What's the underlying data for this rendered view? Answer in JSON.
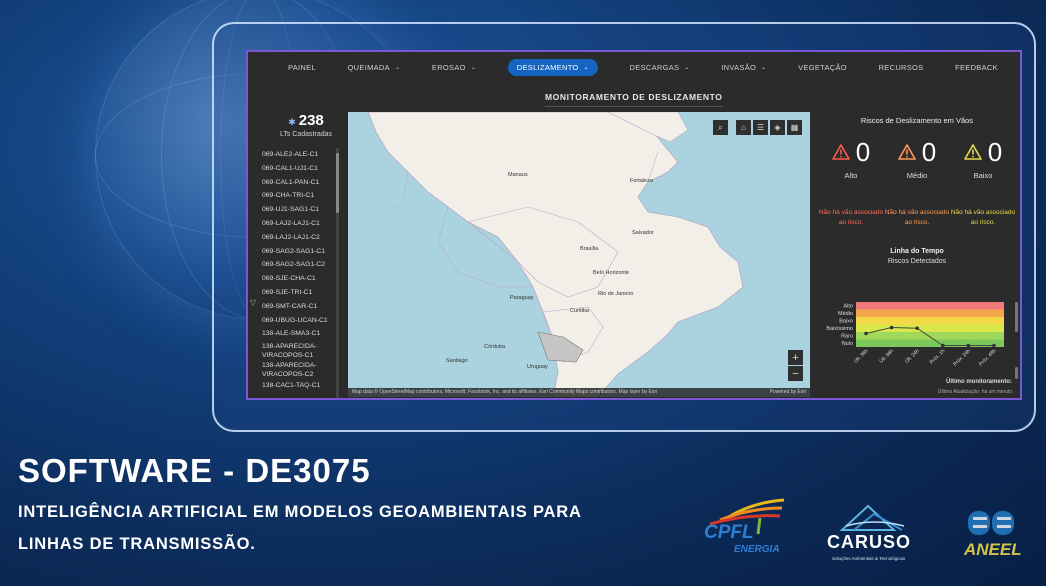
{
  "nav": [
    {
      "label": "PAINEL",
      "chevron": false,
      "active": false
    },
    {
      "label": "QUEIMADA",
      "chevron": true,
      "active": false
    },
    {
      "label": "EROSAO",
      "chevron": true,
      "active": false
    },
    {
      "label": "DESLIZAMENTO",
      "chevron": true,
      "active": true
    },
    {
      "label": "DESCARGAS",
      "chevron": true,
      "active": false
    },
    {
      "label": "INVASÃO",
      "chevron": true,
      "active": false
    },
    {
      "label": "VEGETAÇÃO",
      "chevron": false,
      "active": false
    },
    {
      "label": "RECURSOS",
      "chevron": false,
      "active": false
    },
    {
      "label": "FEEDBACK",
      "chevron": false,
      "active": false
    }
  ],
  "page_title": "MONITORAMENTO DE DESLIZAMENTO",
  "sidebar": {
    "count": "238",
    "count_label": "LTs Cadastradas",
    "items": [
      "069-ALE2-ALE-C1",
      "069-CAL1-UJ1-C1",
      "069-CAL1-PAN-C1",
      "069-CHA-TRI-C1",
      "069-UJ1-SAG1-C1",
      "069-LAJ2-LAJ1-C1",
      "069-LAJ2-LAJ1-C2",
      "069-SAG2-SAG1-C1",
      "069-SAG2-SAG1-C2",
      "069-SJE-CHA-C1",
      "069-SJE-TRI-C1",
      "069-SMT-CAR-C1",
      "069-UBUG-UCAN-C1",
      "138-ALE-SMA3-C1",
      "138-APARECIDA-VIRACOPOS-C1",
      "138-APARECIDA-VIRACOPOS-C2",
      "138-CAC1-TAQ-C1"
    ]
  },
  "map": {
    "cities": [
      "Manaus",
      "Fortaleza",
      "Salvador",
      "Brasília",
      "Belo Horizonte",
      "Rio de Janeiro",
      "Curitiba",
      "Paraguay",
      "Córdoba",
      "Santiago",
      "Uruguay"
    ],
    "attribution": "Map data © OpenStreetMap contributors, Microsoft, Facebook, Inc. and its affiliates, Esri Community Maps contributors, Map layer by Esri",
    "powered": "Powered by Esri",
    "zoom_in": "+",
    "zoom_out": "−"
  },
  "risks": {
    "title": "Riscos de Deslizamento em Vãos",
    "items": [
      {
        "label": "Alto",
        "value": "0",
        "color": "#ff5a4a",
        "msg": "Não há vão associado ao risco."
      },
      {
        "label": "Médio",
        "value": "0",
        "color": "#ff9a55",
        "msg": "Não há vão associado ao risco."
      },
      {
        "label": "Baixo",
        "value": "0",
        "color": "#e9d84a",
        "msg": "Não há vão associado ao risco."
      }
    ]
  },
  "timeline": {
    "title": "Linha do Tempo",
    "subtitle": "Riscos Detectados",
    "last_label": "Último monitoramento:",
    "last_sub": "Última Atualização: há um minuto"
  },
  "chart_data": {
    "type": "line",
    "categories": [
      "Últ. 36h",
      "Últ. 96h",
      "Últ. 24h",
      "Próx. 1h",
      "Próx. 24h",
      "Próx. 48h"
    ],
    "y_levels": [
      "Alto",
      "Médio",
      "Baixo",
      "Baixíssimo",
      "Raro",
      "Nulo"
    ],
    "bands": [
      {
        "level": "Alto",
        "color": "#f07a7a"
      },
      {
        "level": "Médio",
        "color": "#f4a64a"
      },
      {
        "level": "Baixo",
        "color": "#f5d84a"
      },
      {
        "level": "Baixíssimo",
        "color": "#d8e84a"
      },
      {
        "level": "Raro",
        "color": "#9fd85a"
      },
      {
        "level": "Nulo",
        "color": "#7cc85a"
      }
    ],
    "values": [
      1.8,
      2.6,
      2.5,
      0.2,
      0.2,
      0.2
    ],
    "ylim": [
      0,
      6
    ]
  },
  "headline": "SOFTWARE - DE3075",
  "subtitle_lines": [
    "INTELIGÊNCIA ARTIFICIAL EM MODELOS GEOAMBIENTAIS PARA",
    "LINHAS DE TRANSMISSÃO."
  ],
  "logos": {
    "cpfl_1": "CPFL",
    "cpfl_2": "ENERGIA",
    "caruso": "CARUSO",
    "caruso_sub": "Soluções Ambientais & Tecnológicas",
    "aneel": "ANEEL"
  }
}
